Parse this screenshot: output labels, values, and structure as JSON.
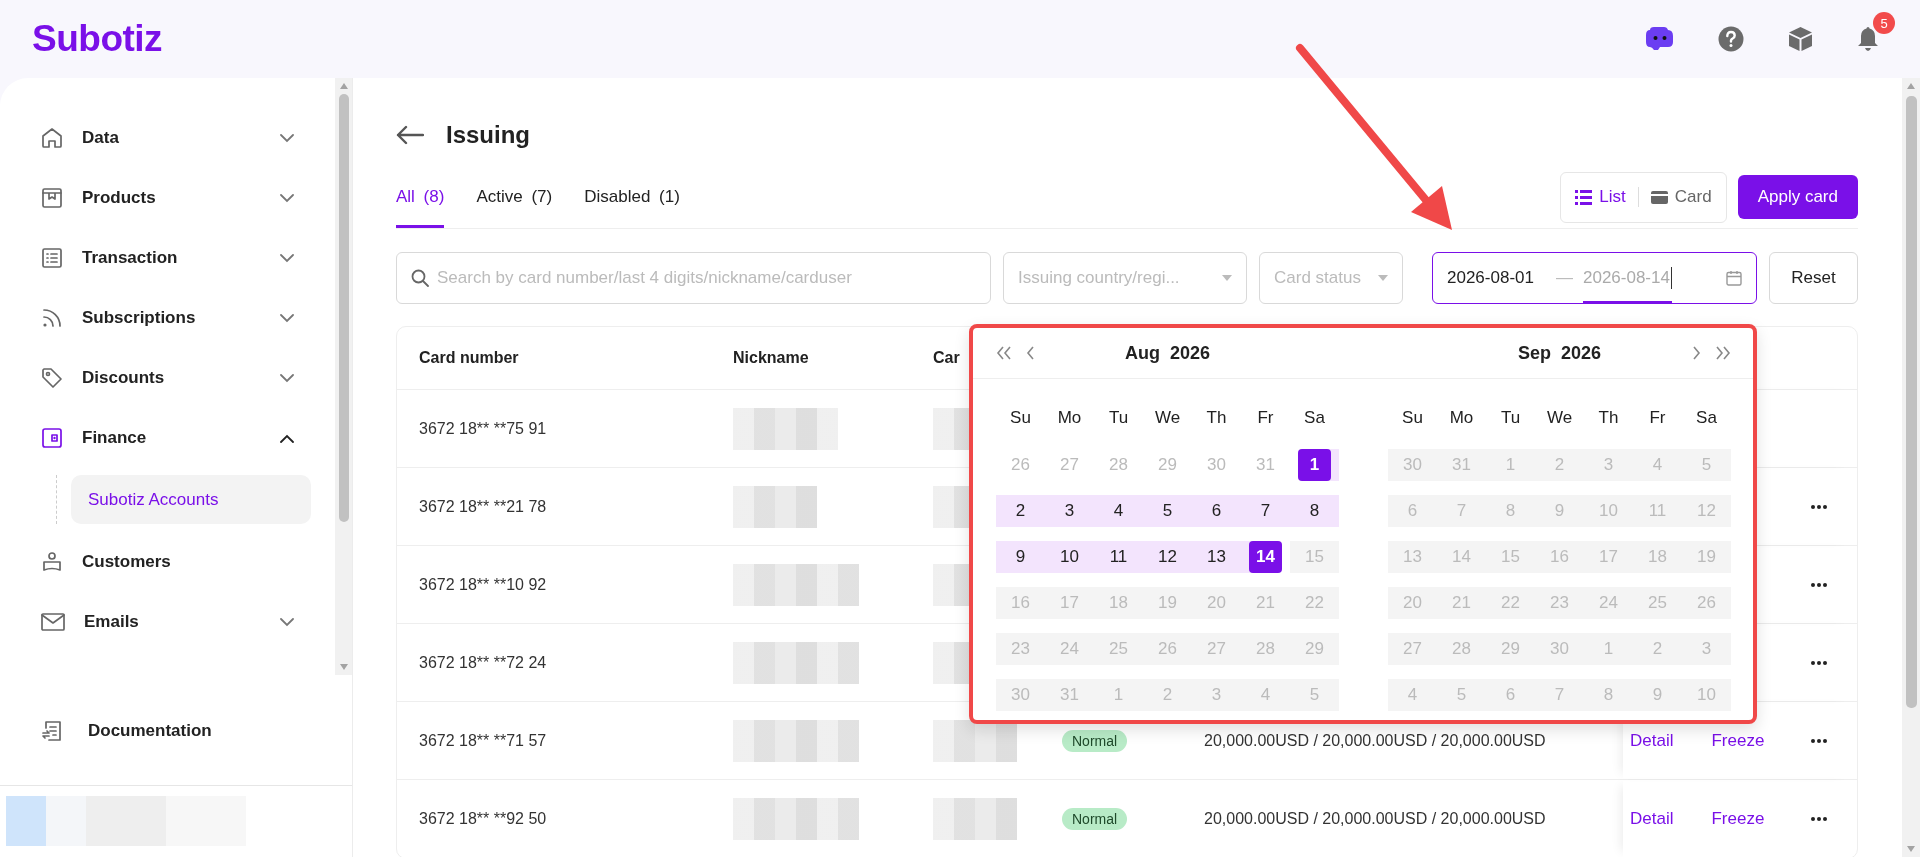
{
  "header": {
    "logo": "Subotiz",
    "notifications": "5"
  },
  "sidebar": {
    "items": [
      {
        "label": "Data",
        "expanded": false
      },
      {
        "label": "Products",
        "expanded": false
      },
      {
        "label": "Transaction",
        "expanded": false
      },
      {
        "label": "Subscriptions",
        "expanded": false
      },
      {
        "label": "Discounts",
        "expanded": false
      },
      {
        "label": "Finance",
        "expanded": true,
        "children": [
          {
            "label": "Subotiz Accounts",
            "selected": true
          }
        ]
      },
      {
        "label": "Customers"
      },
      {
        "label": "Emails",
        "expanded": false
      }
    ],
    "footer": {
      "label": "Documentation"
    }
  },
  "page": {
    "title": "Issuing",
    "tabs": [
      {
        "label": "All (8)",
        "selected": true
      },
      {
        "label": "Active (7)",
        "selected": false
      },
      {
        "label": "Disabled (1)",
        "selected": false
      }
    ],
    "view_toggle": [
      {
        "label": "List",
        "kind": "list",
        "selected": true
      },
      {
        "label": "Card",
        "kind": "card",
        "selected": false
      }
    ],
    "apply_button": "Apply card"
  },
  "filters": {
    "search": {
      "placeholder": "Search by card number/last 4 digits/nickname/carduser"
    },
    "country": {
      "placeholder": "Issuing country/regi..."
    },
    "status": {
      "placeholder": "Card status"
    },
    "date_range": {
      "start": {
        "value": "2026-08-01",
        "focused": false
      },
      "separator": "—",
      "end": {
        "value": "2026-08-14",
        "focused": true
      }
    },
    "reset": "Reset"
  },
  "table": {
    "columns": [
      "Card number",
      "Nickname",
      "Car"
    ],
    "rows": [
      {
        "card_number": "3672 18** **75 91",
        "actions": [],
        "more": false
      },
      {
        "card_number": "3672 18** **21 78",
        "actions": [],
        "more": true
      },
      {
        "card_number": "3672 18** **10 92",
        "actions": [],
        "more": true
      },
      {
        "card_number": "3672 18** **72 24",
        "actions": [],
        "more": true
      },
      {
        "card_number": "3672 18** **71 57",
        "status": "Normal",
        "amount": "20,000.00USD / 20,000.00USD / 20,000.00USD",
        "actions": [
          "Detail",
          "Freeze"
        ],
        "more": true
      },
      {
        "card_number": "3672 18** **92 50",
        "status": "Normal",
        "amount": "20,000.00USD / 20,000.00USD / 20,000.00USD",
        "actions": [
          "Detail",
          "Freeze"
        ],
        "more": true
      }
    ]
  },
  "calendar": {
    "months": [
      {
        "month": "Aug",
        "year": "2026",
        "weekdays": [
          "Su",
          "Mo",
          "Tu",
          "We",
          "Th",
          "Fr",
          "Sa"
        ],
        "weeks": [
          [
            {
              "d": "26",
              "kind": "outside"
            },
            {
              "d": "27",
              "kind": "outside"
            },
            {
              "d": "28",
              "kind": "outside"
            },
            {
              "d": "29",
              "kind": "outside"
            },
            {
              "d": "30",
              "kind": "outside"
            },
            {
              "d": "31",
              "kind": "outside"
            },
            {
              "d": "1",
              "kind": "start"
            }
          ],
          [
            {
              "d": "2",
              "kind": "range"
            },
            {
              "d": "3",
              "kind": "range"
            },
            {
              "d": "4",
              "kind": "range"
            },
            {
              "d": "5",
              "kind": "range"
            },
            {
              "d": "6",
              "kind": "range"
            },
            {
              "d": "7",
              "kind": "range"
            },
            {
              "d": "8",
              "kind": "range"
            }
          ],
          [
            {
              "d": "9",
              "kind": "range"
            },
            {
              "d": "10",
              "kind": "range"
            },
            {
              "d": "11",
              "kind": "range"
            },
            {
              "d": "12",
              "kind": "range"
            },
            {
              "d": "13",
              "kind": "range"
            },
            {
              "d": "14",
              "kind": "end"
            },
            {
              "d": "15",
              "kind": "disabled"
            }
          ],
          [
            {
              "d": "16",
              "kind": "disabled"
            },
            {
              "d": "17",
              "kind": "disabled"
            },
            {
              "d": "18",
              "kind": "disabled"
            },
            {
              "d": "19",
              "kind": "disabled"
            },
            {
              "d": "20",
              "kind": "disabled"
            },
            {
              "d": "21",
              "kind": "disabled"
            },
            {
              "d": "22",
              "kind": "disabled"
            }
          ],
          [
            {
              "d": "23",
              "kind": "disabled"
            },
            {
              "d": "24",
              "kind": "disabled"
            },
            {
              "d": "25",
              "kind": "disabled"
            },
            {
              "d": "26",
              "kind": "disabled"
            },
            {
              "d": "27",
              "kind": "disabled"
            },
            {
              "d": "28",
              "kind": "disabled"
            },
            {
              "d": "29",
              "kind": "disabled"
            }
          ],
          [
            {
              "d": "30",
              "kind": "disabled"
            },
            {
              "d": "31",
              "kind": "disabled"
            },
            {
              "d": "1",
              "kind": "disabled"
            },
            {
              "d": "2",
              "kind": "disabled"
            },
            {
              "d": "3",
              "kind": "disabled"
            },
            {
              "d": "4",
              "kind": "disabled"
            },
            {
              "d": "5",
              "kind": "disabled"
            }
          ]
        ]
      },
      {
        "month": "Sep",
        "year": "2026",
        "weekdays": [
          "Su",
          "Mo",
          "Tu",
          "We",
          "Th",
          "Fr",
          "Sa"
        ],
        "weeks": [
          [
            {
              "d": "30",
              "kind": "disabled"
            },
            {
              "d": "31",
              "kind": "disabled"
            },
            {
              "d": "1",
              "kind": "disabled"
            },
            {
              "d": "2",
              "kind": "disabled"
            },
            {
              "d": "3",
              "kind": "disabled"
            },
            {
              "d": "4",
              "kind": "disabled"
            },
            {
              "d": "5",
              "kind": "disabled"
            }
          ],
          [
            {
              "d": "6",
              "kind": "disabled"
            },
            {
              "d": "7",
              "kind": "disabled"
            },
            {
              "d": "8",
              "kind": "disabled"
            },
            {
              "d": "9",
              "kind": "disabled"
            },
            {
              "d": "10",
              "kind": "disabled"
            },
            {
              "d": "11",
              "kind": "disabled"
            },
            {
              "d": "12",
              "kind": "disabled"
            }
          ],
          [
            {
              "d": "13",
              "kind": "disabled"
            },
            {
              "d": "14",
              "kind": "disabled"
            },
            {
              "d": "15",
              "kind": "disabled"
            },
            {
              "d": "16",
              "kind": "disabled"
            },
            {
              "d": "17",
              "kind": "disabled"
            },
            {
              "d": "18",
              "kind": "disabled"
            },
            {
              "d": "19",
              "kind": "disabled"
            }
          ],
          [
            {
              "d": "20",
              "kind": "disabled"
            },
            {
              "d": "21",
              "kind": "disabled"
            },
            {
              "d": "22",
              "kind": "disabled"
            },
            {
              "d": "23",
              "kind": "disabled"
            },
            {
              "d": "24",
              "kind": "disabled"
            },
            {
              "d": "25",
              "kind": "disabled"
            },
            {
              "d": "26",
              "kind": "disabled"
            }
          ],
          [
            {
              "d": "27",
              "kind": "disabled"
            },
            {
              "d": "28",
              "kind": "disabled"
            },
            {
              "d": "29",
              "kind": "disabled"
            },
            {
              "d": "30",
              "kind": "disabled"
            },
            {
              "d": "1",
              "kind": "disabled"
            },
            {
              "d": "2",
              "kind": "disabled"
            },
            {
              "d": "3",
              "kind": "disabled"
            }
          ],
          [
            {
              "d": "4",
              "kind": "disabled"
            },
            {
              "d": "5",
              "kind": "disabled"
            },
            {
              "d": "6",
              "kind": "disabled"
            },
            {
              "d": "7",
              "kind": "disabled"
            },
            {
              "d": "8",
              "kind": "disabled"
            },
            {
              "d": "9",
              "kind": "disabled"
            },
            {
              "d": "10",
              "kind": "disabled"
            }
          ]
        ]
      }
    ]
  }
}
